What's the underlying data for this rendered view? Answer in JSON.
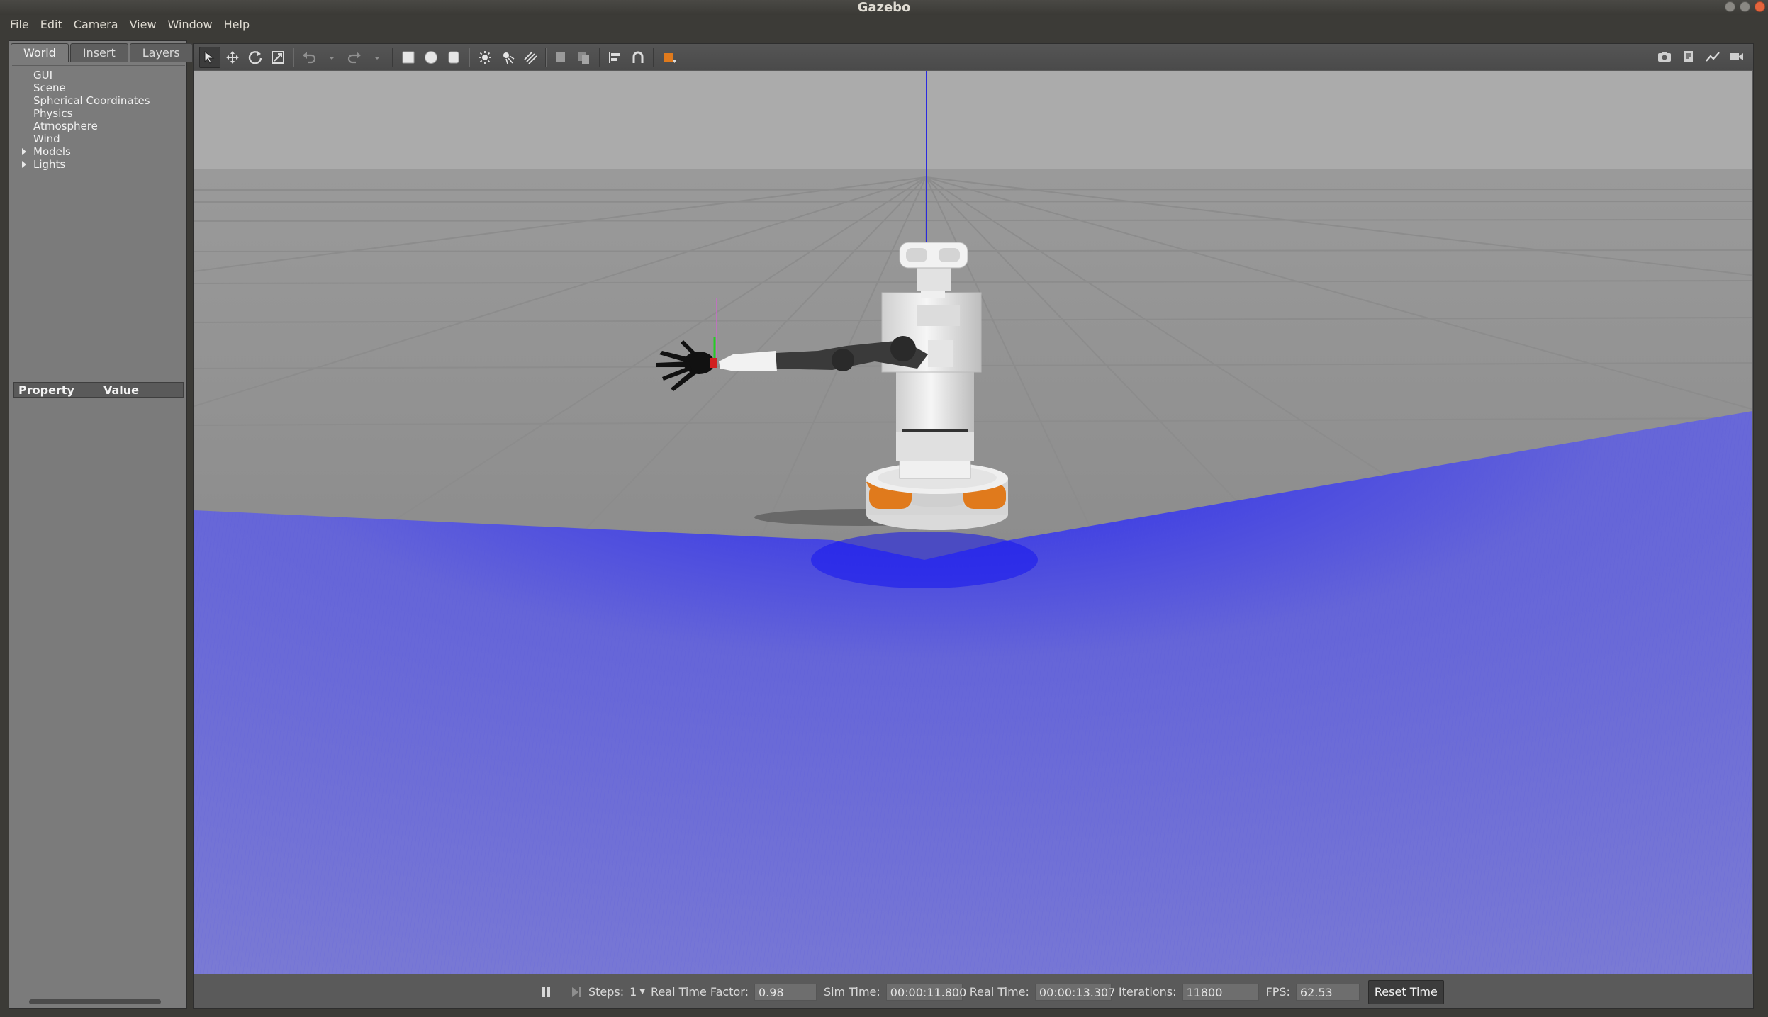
{
  "window": {
    "title": "Gazebo"
  },
  "menu": [
    "File",
    "Edit",
    "Camera",
    "View",
    "Window",
    "Help"
  ],
  "left_panel": {
    "tabs": [
      "World",
      "Insert",
      "Layers"
    ],
    "active_tab": "World",
    "tree": [
      {
        "label": "GUI",
        "expandable": false
      },
      {
        "label": "Scene",
        "expandable": false
      },
      {
        "label": "Spherical Coordinates",
        "expandable": false
      },
      {
        "label": "Physics",
        "expandable": false
      },
      {
        "label": "Atmosphere",
        "expandable": false
      },
      {
        "label": "Wind",
        "expandable": false
      },
      {
        "label": "Models",
        "expandable": true
      },
      {
        "label": "Lights",
        "expandable": true
      }
    ],
    "property_header": {
      "property": "Property",
      "value": "Value"
    }
  },
  "toolbar": {
    "left_icons": [
      "select-arrow-icon",
      "translate-icon",
      "rotate-icon",
      "scale-icon",
      "undo-icon",
      "redo-icon",
      "box-icon",
      "sphere-icon",
      "cylinder-icon",
      "point-light-icon",
      "spot-light-icon",
      "directional-light-icon",
      "copy-icon",
      "paste-icon",
      "align-icon",
      "snap-icon",
      "view-angle-icon"
    ],
    "right_icons": [
      "screenshot-icon",
      "log-icon",
      "plot-icon",
      "video-record-icon"
    ]
  },
  "bottom_bar": {
    "steps_label": "Steps:",
    "steps_value": "1",
    "rtf_label": "Real Time Factor:",
    "rtf_value": "0.98",
    "sim_time_label": "Sim Time:",
    "sim_time_value": "00:00:11.800",
    "real_time_label": "Real Time:",
    "real_time_value": "00:00:13.307",
    "iterations_label": "Iterations:",
    "iterations_value": "11800",
    "fps_label": "FPS:",
    "fps_value": "62.53",
    "reset_label": "Reset Time"
  },
  "colors": {
    "laser_scan": "#3b3bf0",
    "robot_accent": "#e07a1c",
    "sky": "#a5a5a5",
    "ground": "#8a8a8a"
  }
}
